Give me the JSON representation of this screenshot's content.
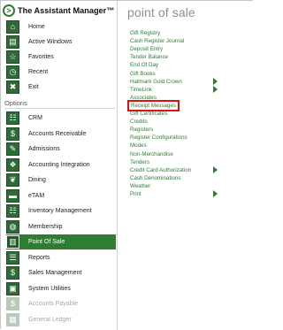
{
  "app": {
    "title": "The Assistant Manager™"
  },
  "top_nav": [
    {
      "label": "Home",
      "icon": "home-icon",
      "glyph": "⌂"
    },
    {
      "label": "Active Windows",
      "icon": "windows-icon",
      "glyph": "▤"
    },
    {
      "label": "Favorites",
      "icon": "star-icon",
      "glyph": "☆"
    },
    {
      "label": "Recent",
      "icon": "clock-icon",
      "glyph": "◷"
    },
    {
      "label": "Exit",
      "icon": "exit-icon",
      "glyph": "✖"
    }
  ],
  "options": {
    "label": "Options",
    "items": [
      {
        "label": "CRM",
        "icon": "crm-icon",
        "glyph": "☷",
        "state": "normal"
      },
      {
        "label": "Accounts Receivable",
        "icon": "accounts-receivable-icon",
        "glyph": "$",
        "state": "normal"
      },
      {
        "label": "Admissions",
        "icon": "admissions-icon",
        "glyph": "✎",
        "state": "normal"
      },
      {
        "label": "Accounting Integration",
        "icon": "accounting-integration-icon",
        "glyph": "❖",
        "state": "normal"
      },
      {
        "label": "Dining",
        "icon": "dining-icon",
        "glyph": "❦",
        "state": "normal"
      },
      {
        "label": "eTAM",
        "icon": "etam-icon",
        "glyph": "▬",
        "state": "normal"
      },
      {
        "label": "Inventory Management",
        "icon": "inventory-icon",
        "glyph": "☷",
        "state": "normal"
      },
      {
        "label": "Membership",
        "icon": "membership-icon",
        "glyph": "◍",
        "state": "normal"
      },
      {
        "label": "Point Of Sale",
        "icon": "point-of-sale-icon",
        "glyph": "▥",
        "state": "selected"
      },
      {
        "label": "Reports",
        "icon": "reports-icon",
        "glyph": "☰",
        "state": "normal"
      },
      {
        "label": "Sales Management",
        "icon": "sales-management-icon",
        "glyph": "$",
        "state": "normal"
      },
      {
        "label": "System Utilities",
        "icon": "system-utilities-icon",
        "glyph": "▣",
        "state": "normal"
      },
      {
        "label": "Accounts Payable",
        "icon": "accounts-payable-icon",
        "glyph": "$",
        "state": "disabled"
      },
      {
        "label": "General Ledger",
        "icon": "general-ledger-icon",
        "glyph": "▦",
        "state": "disabled"
      }
    ]
  },
  "submenu": {
    "title": "point of sale",
    "items": [
      {
        "label": "Gift Registry",
        "has_submenu": false,
        "highlighted": false
      },
      {
        "label": "Cash Register Journal",
        "has_submenu": false,
        "highlighted": false
      },
      {
        "label": "Deposit Entry",
        "has_submenu": false,
        "highlighted": false
      },
      {
        "label": "Tender Balance",
        "has_submenu": false,
        "highlighted": false
      },
      {
        "label": "End Of Day",
        "has_submenu": false,
        "highlighted": false
      },
      {
        "label": "Gift Books",
        "has_submenu": false,
        "highlighted": false
      },
      {
        "label": "Hallmark Gold Crown",
        "has_submenu": true,
        "highlighted": false
      },
      {
        "label": "TimeLink",
        "has_submenu": true,
        "highlighted": false
      },
      {
        "label": "Associates",
        "has_submenu": false,
        "highlighted": false
      },
      {
        "label": "Receipt Messages",
        "has_submenu": false,
        "highlighted": true
      },
      {
        "label": "Gift Certificates",
        "has_submenu": false,
        "highlighted": false
      },
      {
        "label": "Credits",
        "has_submenu": false,
        "highlighted": false
      },
      {
        "label": "Registers",
        "has_submenu": false,
        "highlighted": false
      },
      {
        "label": "Register Configurations",
        "has_submenu": false,
        "highlighted": false
      },
      {
        "label": "Modes",
        "has_submenu": false,
        "highlighted": false
      },
      {
        "label": "Non-Merchandise",
        "has_submenu": false,
        "highlighted": false
      },
      {
        "label": "Tenders",
        "has_submenu": false,
        "highlighted": false
      },
      {
        "label": "Credit Card Authorization",
        "has_submenu": true,
        "highlighted": false
      },
      {
        "label": "Cash Denominations",
        "has_submenu": false,
        "highlighted": false
      },
      {
        "label": "Weather",
        "has_submenu": false,
        "highlighted": false
      },
      {
        "label": "Print",
        "has_submenu": true,
        "highlighted": false
      }
    ]
  },
  "colors": {
    "accent": "#2e7d32",
    "highlight_box": "#e01010",
    "title_gray": "#8a8f98"
  }
}
